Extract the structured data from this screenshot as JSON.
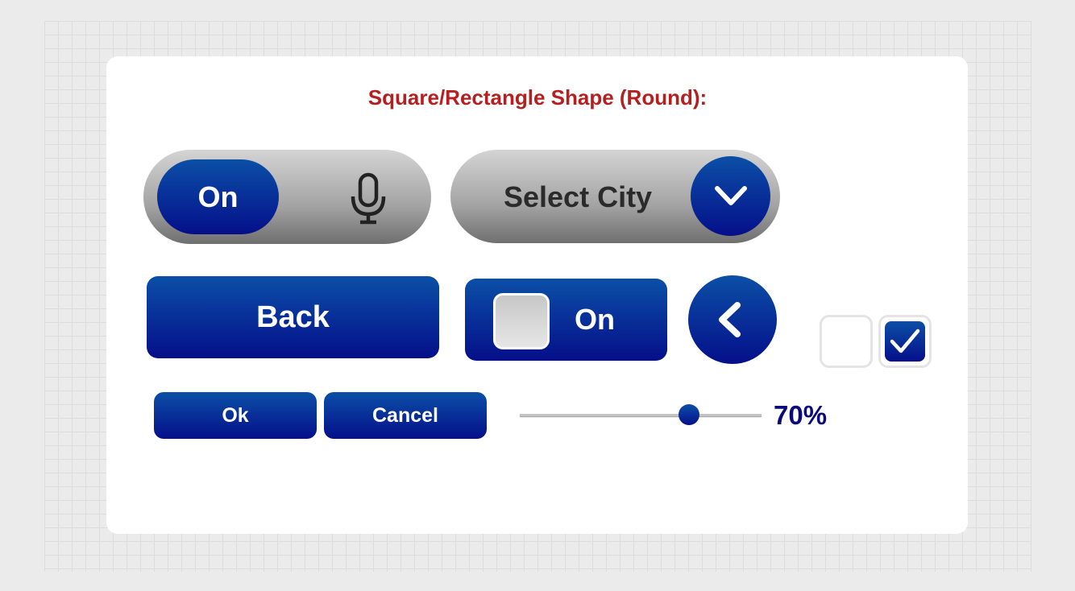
{
  "title": "Square/Rectangle Shape (Round):",
  "colors": {
    "title": "#b51f1f",
    "primary_top": "#0b4fa6",
    "primary_bottom": "#050f8a",
    "grey_top": "#d4d4d4",
    "grey_bottom": "#6f6f6f"
  },
  "mic_toggle": {
    "label": "On",
    "icon": "microphone-icon",
    "state": "on"
  },
  "select_city": {
    "label": "Select City",
    "icon": "chevron-down-icon"
  },
  "back_button": {
    "label": "Back"
  },
  "square_toggle": {
    "label": "On",
    "state": "on"
  },
  "circle_back": {
    "icon": "chevron-left-icon"
  },
  "checkboxes": [
    {
      "checked": false
    },
    {
      "checked": true,
      "icon": "checkmark-icon"
    }
  ],
  "ok_button": {
    "label": "Ok"
  },
  "cancel_button": {
    "label": "Cancel"
  },
  "slider": {
    "value": 0.7,
    "display": "70%"
  }
}
